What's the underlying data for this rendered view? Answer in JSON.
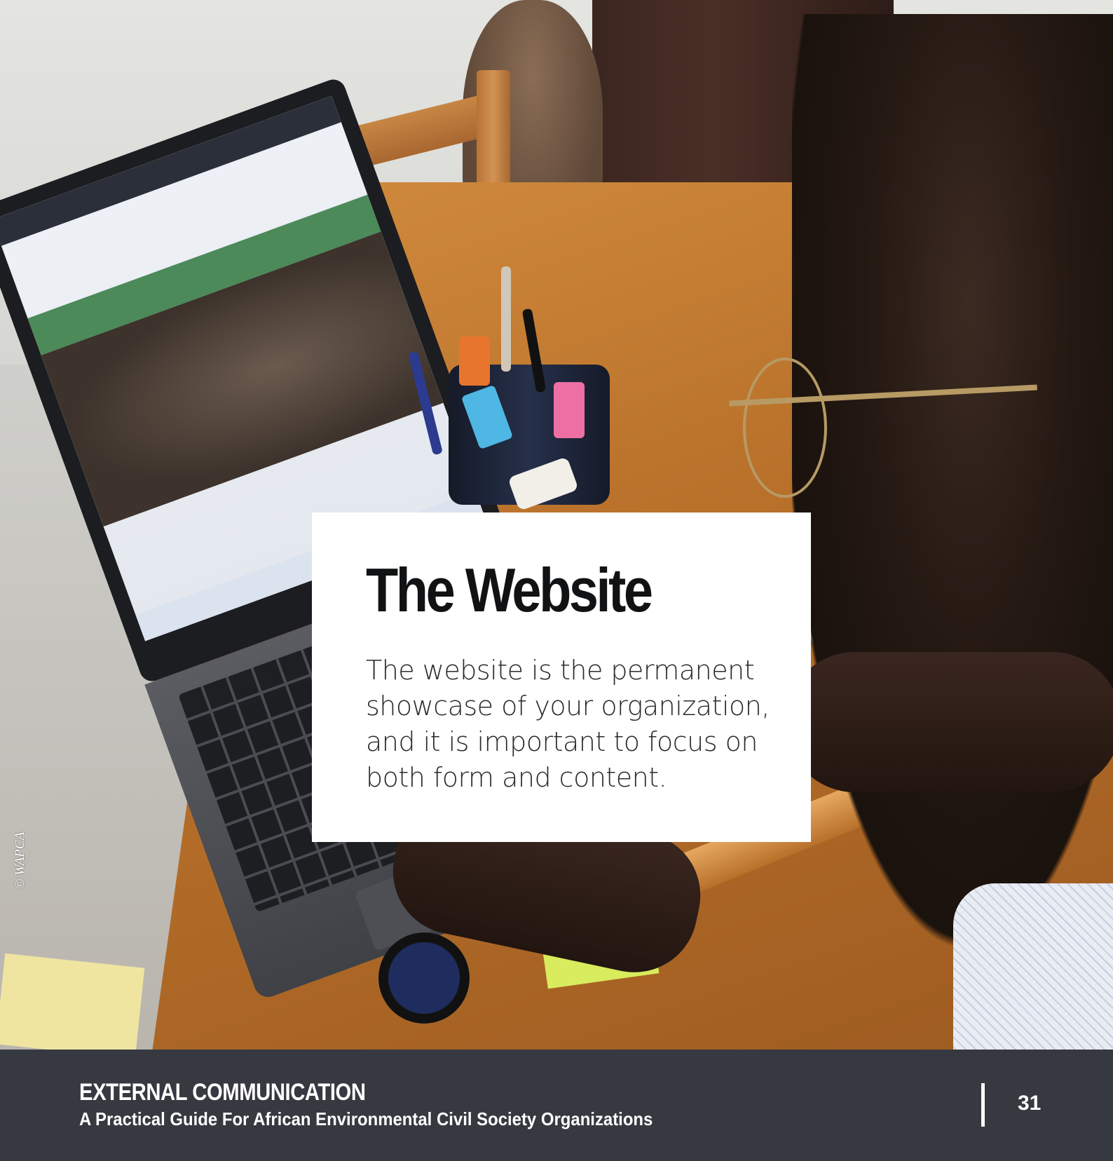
{
  "photo": {
    "credit": "© WAPCA"
  },
  "card": {
    "title": "The Website",
    "body": "The website is the permanent showcase of your organization, and it is important to focus on both form and content."
  },
  "footer": {
    "title": "EXTERNAL COMMUNICATION",
    "subtitle": "A Practical Guide For African Environmental Civil Society Organizations",
    "page_number": "31"
  },
  "colors": {
    "footer_background": "#363940",
    "card_background": "#ffffff",
    "title_text": "#111214"
  }
}
